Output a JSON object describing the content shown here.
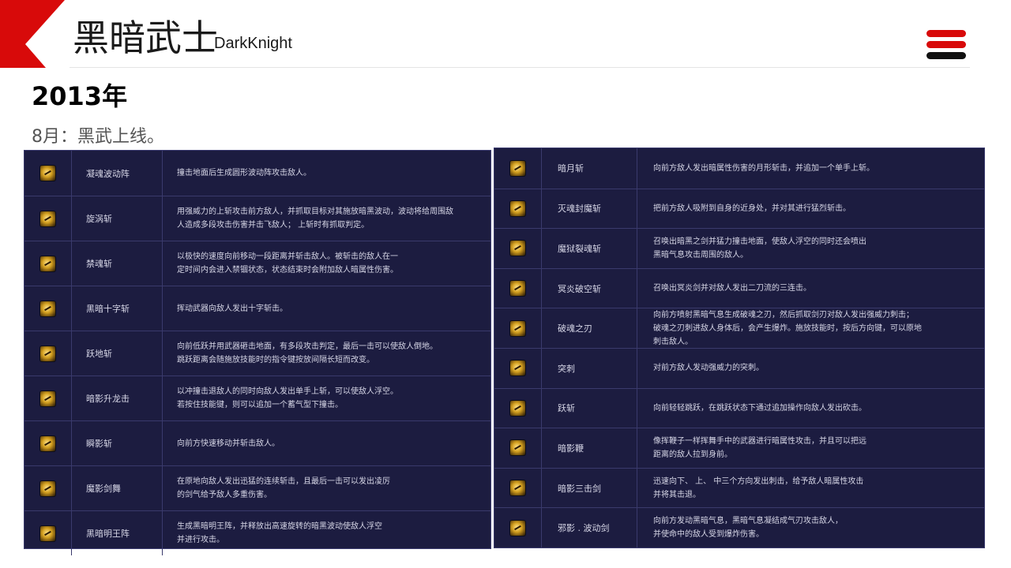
{
  "header": {
    "title": "黑暗武士",
    "subtitle": "DarkKnight",
    "accent_color": "#d80a0a",
    "menu_icon": "hamburger-menu-icon"
  },
  "main": {
    "year": "2013年",
    "note": "8月：黑武上线。"
  },
  "skills_left": [
    {
      "icon": "skill-icon",
      "name": "凝魂波动阵",
      "desc": [
        "撞击地面后生成圆形波动阵攻击敌人。"
      ]
    },
    {
      "icon": "skill-icon",
      "name": "旋涡斩",
      "desc": [
        "用强威力的上斩攻击前方敌人，并抓取目标对其施放暗黑波动，波动将给周围敌",
        "人造成多段攻击伤害并击飞敌人； 上斩时有抓取判定。"
      ]
    },
    {
      "icon": "skill-icon",
      "name": "禁魂斩",
      "desc": [
        "以极快的速度向前移动一段距离并斩击敌人。被斩击的敌人在一",
        "定时间内会进入禁锢状态，状态结束时会附加敌人暗属性伤害。"
      ]
    },
    {
      "icon": "skill-icon",
      "name": "黑暗十字斩",
      "desc": [
        "挥动武器向敌人发出十字斩击。"
      ]
    },
    {
      "icon": "skill-icon",
      "name": "跃地斩",
      "desc": [
        "向前低跃并用武器砸击地面，有多段攻击判定，最后一击可以使敌人倒地。",
        "跳跃距离会随施放技能时的指令键按放间隔长短而改变。"
      ]
    },
    {
      "icon": "skill-icon",
      "name": "暗影升龙击",
      "desc": [
        "以冲撞击退敌人的同时向敌人发出单手上斩，可以使敌人浮空。",
        "若按住技能键，则可以追加一个蓄气型下撞击。"
      ]
    },
    {
      "icon": "skill-icon",
      "name": "瞬影斩",
      "desc": [
        "向前方快速移动并斩击敌人。"
      ]
    },
    {
      "icon": "skill-icon",
      "name": "魔影剑舞",
      "desc": [
        "在原地向敌人发出迅猛的连续斩击，且最后一击可以发出凌厉",
        "的剑气给予敌人多重伤害。"
      ]
    },
    {
      "icon": "skill-icon",
      "name": "黑暗明王阵",
      "desc": [
        "生成黑暗明王阵，并释放出高速旋转的暗黑波动使敌人浮空",
        "并进行攻击。"
      ]
    }
  ],
  "skills_right": [
    {
      "icon": "skill-icon",
      "name": "暗月斩",
      "desc": [
        "向前方敌人发出暗属性伤害的月形斩击，并追加一个单手上斩。"
      ]
    },
    {
      "icon": "skill-icon",
      "name": "灭魂封魔斩",
      "desc": [
        "把前方敌人吸附到自身的近身处，并对其进行猛烈斩击。"
      ]
    },
    {
      "icon": "skill-icon",
      "name": "魔狱裂魂斩",
      "desc": [
        "召唤出暗黑之剑并猛力撞击地面，使敌人浮空的同时还会喷出",
        "黑暗气息攻击周围的敌人。"
      ]
    },
    {
      "icon": "skill-icon",
      "name": "冥炎破空斩",
      "desc": [
        "召唤出冥炎剑并对敌人发出二刀流的三连击。"
      ]
    },
    {
      "icon": "skill-icon",
      "name": "破魂之刃",
      "desc": [
        "向前方喷射黑暗气息生成破魂之刃，然后抓取剑刃对敌人发出强威力刺击；",
        "破魂之刃刺进敌人身体后，会产生爆炸。施放技能时，按后方向键，可以原地",
        "刺击敌人。"
      ]
    },
    {
      "icon": "skill-icon",
      "name": "突刺",
      "desc": [
        "对前方敌人发动强威力的突刺。"
      ]
    },
    {
      "icon": "skill-icon",
      "name": "跃斩",
      "desc": [
        "向前轻轻跳跃，在跳跃状态下通过追加操作向敌人发出砍击。"
      ]
    },
    {
      "icon": "skill-icon",
      "name": "暗影鞭",
      "desc": [
        "像挥鞭子一样挥舞手中的武器进行暗属性攻击，并且可以把远",
        "距离的敌人拉到身前。"
      ]
    },
    {
      "icon": "skill-icon",
      "name": "暗影三击剑",
      "desc": [
        "迅速向下、 上、 中三个方向发出刺击，给予敌人暗属性攻击",
        "并将其击退。"
      ]
    },
    {
      "icon": "skill-icon",
      "name": "邪影 . 波动剑",
      "desc": [
        "向前方发动黑暗气息，黑暗气息凝结成气刃攻击敌人，",
        "并使命中的敌人受到爆炸伤害。"
      ]
    }
  ]
}
